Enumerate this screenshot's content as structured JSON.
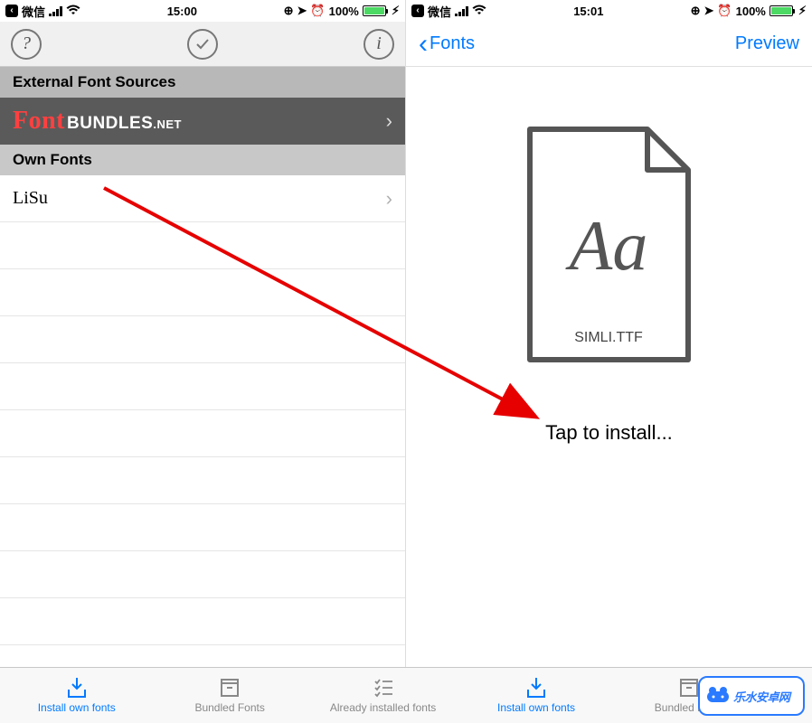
{
  "left": {
    "status": {
      "carrier": "微信",
      "time": "15:00",
      "battery": "100%"
    },
    "toolbar": {
      "help": "?",
      "info": "i"
    },
    "sections": {
      "external": "External Font Sources",
      "own": "Own Fonts"
    },
    "fontbundles": {
      "font": "Font",
      "bundles": "BUNDLES",
      "net": ".NET"
    },
    "font_name": "LiSu",
    "tabs": {
      "install": "Install own fonts",
      "bundled": "Bundled Fonts",
      "already": "Already installed fonts"
    }
  },
  "right": {
    "status": {
      "carrier": "微信",
      "time": "15:01",
      "battery": "100%"
    },
    "nav": {
      "back": "Fonts",
      "preview": "Preview"
    },
    "file": {
      "aa": "Aa",
      "name": "SIMLI.TTF"
    },
    "tap": "Tap to install...",
    "tabs": {
      "install": "Install own fonts",
      "bundled": "Bundled Fonts"
    }
  },
  "watermark": "乐水安卓网"
}
